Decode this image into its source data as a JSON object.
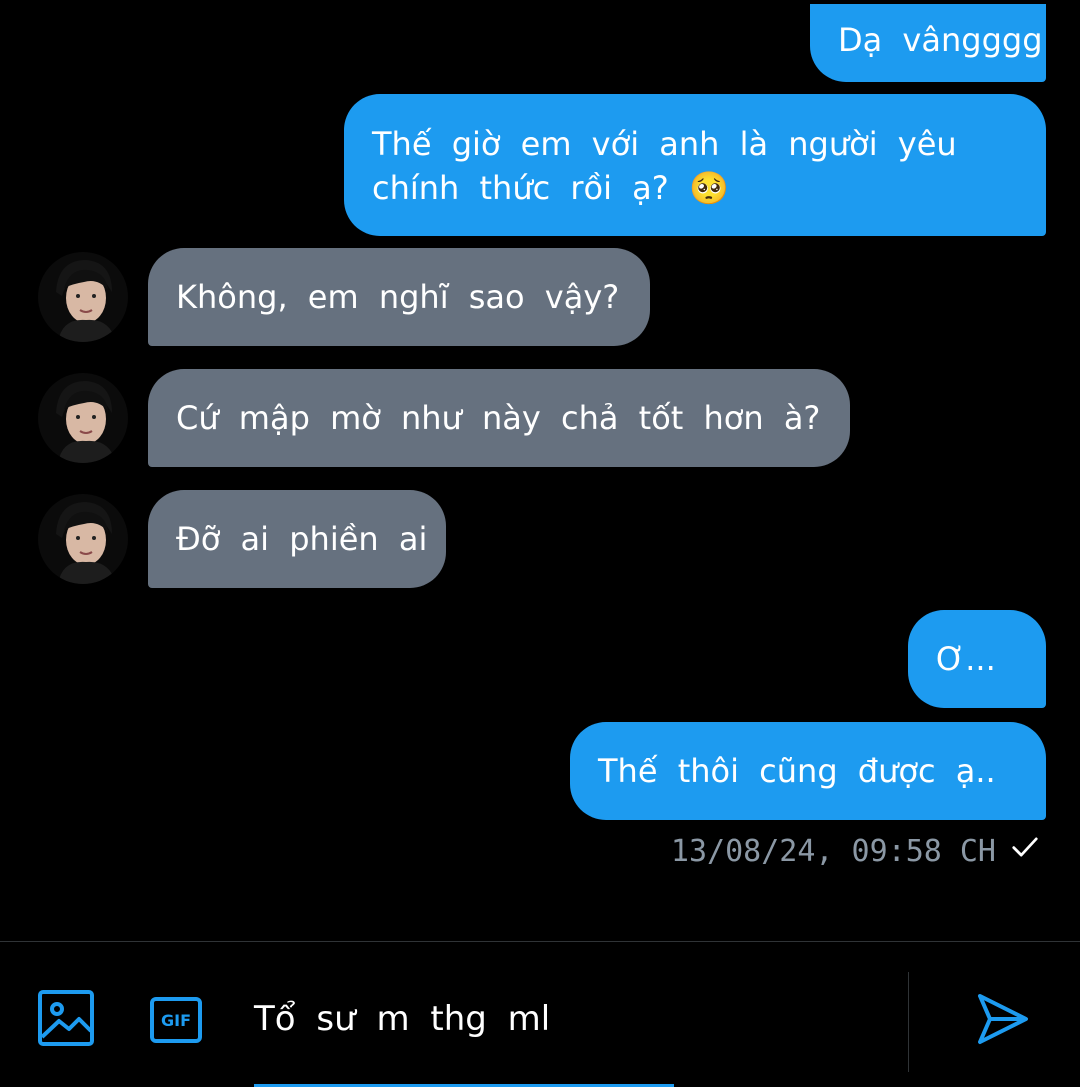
{
  "thread": {
    "messages": [
      {
        "side": "out",
        "text": "Dạ vângggg"
      },
      {
        "side": "out",
        "line1": "Thế giờ em với anh là người yêu",
        "line2": "chính thức rồi ạ? 🥺"
      },
      {
        "side": "in",
        "text": "Không, em nghĩ sao vậy?"
      },
      {
        "side": "in",
        "text": "Cứ mập mờ như này chả tốt hơn à?"
      },
      {
        "side": "in",
        "text": "Đỡ ai phiền ai"
      },
      {
        "side": "out",
        "text": "Ơ..."
      },
      {
        "side": "out",
        "text": "Thế thôi cũng được ạ.."
      }
    ],
    "timestamp": "13/08/24, 09:58 CH",
    "status_icon": "checkmark-icon"
  },
  "composer": {
    "value": "Tổ sư m thg ml",
    "image_icon": "image-icon",
    "gif_label": "GIF",
    "send_icon": "send-icon"
  },
  "colors": {
    "background": "#000000",
    "outgoing_bubble": "#1d9bf0",
    "incoming_bubble": "#66717f",
    "accent": "#1d9bf0",
    "meta_text": "#8b98a5"
  }
}
